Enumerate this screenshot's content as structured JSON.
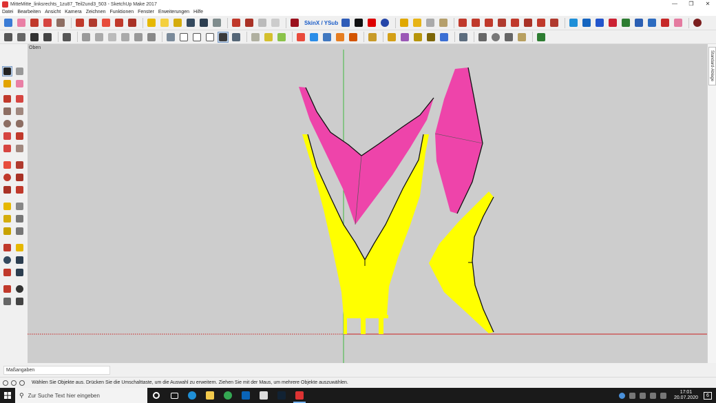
{
  "window": {
    "title": "MitteMitte_linksrechts_1zu87_Teil2und3_503 - SketchUp Make 2017",
    "controls": {
      "minimize": "—",
      "maximize": "❒",
      "close": "✕"
    }
  },
  "menu": [
    "Datei",
    "Bearbeiten",
    "Ansicht",
    "Kamera",
    "Zeichnen",
    "Funktionen",
    "Fenster",
    "Erweiterungen",
    "Hilfe"
  ],
  "toolbar": {
    "skinx_label": "SkinX / YSub"
  },
  "viewport": {
    "scene_label": "Oben",
    "background": "#cdcdcd",
    "colors": {
      "magenta": "#ee44aa",
      "yellow": "#ffff00",
      "green_axis": "#3fb93f",
      "red_axis": "#cc2020",
      "edges": "#111111"
    }
  },
  "tray": {
    "tab_label": "Standard-Ablage"
  },
  "measurements": {
    "label": "Maßangaben"
  },
  "status": {
    "text": "Wählen Sie Objekte aus. Drücken Sie die Umschalttaste, um die Auswahl zu erweitern. Ziehen Sie mit der Maus, um mehrere Objekte auszuwählen."
  },
  "taskbar": {
    "search_placeholder": "Zur Suche Text hier eingeben",
    "time": "17:01",
    "date": "20.07.2020",
    "notification_count": "6"
  },
  "icons": [
    "select-icon",
    "eraser-icon",
    "pencil-icon",
    "arc-icon",
    "rectangle-icon",
    "push-pull-icon",
    "move-icon",
    "rotate-icon",
    "scale-icon",
    "offset-icon",
    "tape-measure-icon",
    "text-icon",
    "orbit-icon",
    "pan-icon",
    "zoom-icon",
    "zoom-extents-icon",
    "warehouse-icon",
    "extension-icon"
  ]
}
